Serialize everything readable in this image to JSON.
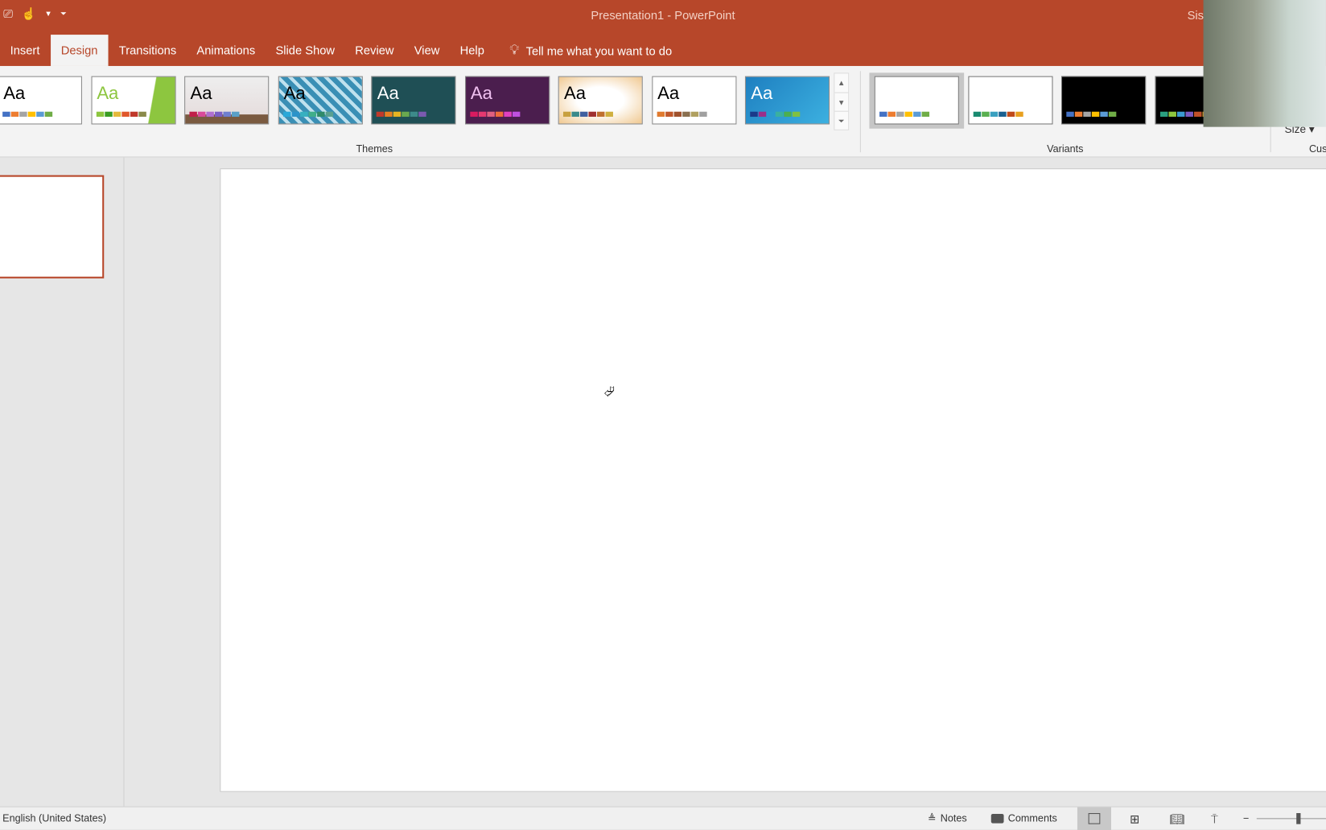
{
  "window": {
    "title": "Presentation1  -  PowerPoint",
    "user": "Sisi"
  },
  "qat": {
    "icons": [
      "presenter-icon",
      "touch-mode-icon",
      "dropdown-icon",
      "customize-icon"
    ]
  },
  "tabs": [
    {
      "label": "Insert"
    },
    {
      "label": "Design",
      "active": true
    },
    {
      "label": "Transitions"
    },
    {
      "label": "Animations"
    },
    {
      "label": "Slide Show"
    },
    {
      "label": "Review"
    },
    {
      "label": "View"
    },
    {
      "label": "Help"
    }
  ],
  "tell_me": "Tell me what you want to do",
  "themes": {
    "label": "Themes",
    "items": [
      {
        "bg": "#ffffff",
        "fg": "#000",
        "colors": [
          "#4472c4",
          "#ed7d31",
          "#a5a5a5",
          "#ffc000",
          "#5b9bd5",
          "#70ad47"
        ]
      },
      {
        "bg": "linear-gradient(100deg,#fff 70%,#8dc63f 71%)",
        "fg": "#8dc63f",
        "colors": [
          "#8dc63f",
          "#3a9d23",
          "#e4b93b",
          "#e0582b",
          "#c0392b",
          "#8a8a4a"
        ]
      },
      {
        "bg": "linear-gradient(#eee,#e6dede 80%,#7a5a40 81%)",
        "fg": "#000",
        "colors": [
          "#c0204a",
          "#d94a9a",
          "#b06fd0",
          "#7b5fc4",
          "#6f7fd0",
          "#5aa0c8"
        ]
      },
      {
        "bg": "repeating-linear-gradient(45deg,#3a8fb5 0 6px,#bfe1ee 6px 10px)",
        "fg": "#000",
        "colors": [
          "#2aa8d8",
          "#2c93c9",
          "#36b0c0",
          "#3fae8a",
          "#2f8a6a",
          "#5aa090"
        ]
      },
      {
        "bg": "#1f4f55",
        "fg": "#fff",
        "colors": [
          "#c0392b",
          "#e67e22",
          "#e6b422",
          "#6aa84f",
          "#3d8a8a",
          "#7a5ab0"
        ]
      },
      {
        "bg": "#4b1e4e",
        "fg": "#f0c0f0",
        "colors": [
          "#d81b60",
          "#e53970",
          "#e06080",
          "#ef6c3a",
          "#e040c0",
          "#c050e0"
        ]
      },
      {
        "bg": "radial-gradient(#fff 40%,#f0c890)",
        "fg": "#000",
        "colors": [
          "#c8a040",
          "#3a8a8a",
          "#4060a0",
          "#a03030",
          "#c07030",
          "#d0b040"
        ]
      },
      {
        "bg": "#ffffff",
        "fg": "#000",
        "colors": [
          "#e07b30",
          "#c0582b",
          "#a0522d",
          "#8a7050",
          "#b0a060",
          "#a0a0a0"
        ]
      },
      {
        "bg": "linear-gradient(135deg,#1e7fc0,#3cb0e0)",
        "fg": "#fff",
        "colors": [
          "#1a3a8a",
          "#9b2f8a",
          "#2a9ad0",
          "#3ab0a0",
          "#4caf50",
          "#80c040"
        ]
      }
    ]
  },
  "variants": {
    "label": "Variants",
    "items": [
      {
        "bg": "#ffffff",
        "colors": [
          "#4472c4",
          "#ed7d31",
          "#a5a5a5",
          "#ffc000",
          "#5b9bd5",
          "#70ad47"
        ],
        "selected": true
      },
      {
        "bg": "#ffffff",
        "colors": [
          "#1a8a70",
          "#5ab050",
          "#3aa0c0",
          "#1a6090",
          "#c04a1a",
          "#e8a020"
        ]
      },
      {
        "bg": "#000000",
        "colors": [
          "#4472c4",
          "#ed7d31",
          "#a5a5a5",
          "#ffc000",
          "#5b9bd5",
          "#70ad47"
        ]
      },
      {
        "bg": "#000000",
        "colors": [
          "#2aa080",
          "#8dc63f",
          "#3a9ad0",
          "#7a5ac0",
          "#c0502a",
          "#e0a020"
        ]
      }
    ]
  },
  "customize": {
    "label": "Cus",
    "slide_size": "Size"
  },
  "status": {
    "language": "English (United States)",
    "notes": "Notes",
    "comments": "Comments"
  },
  "accent": "#b7472a"
}
